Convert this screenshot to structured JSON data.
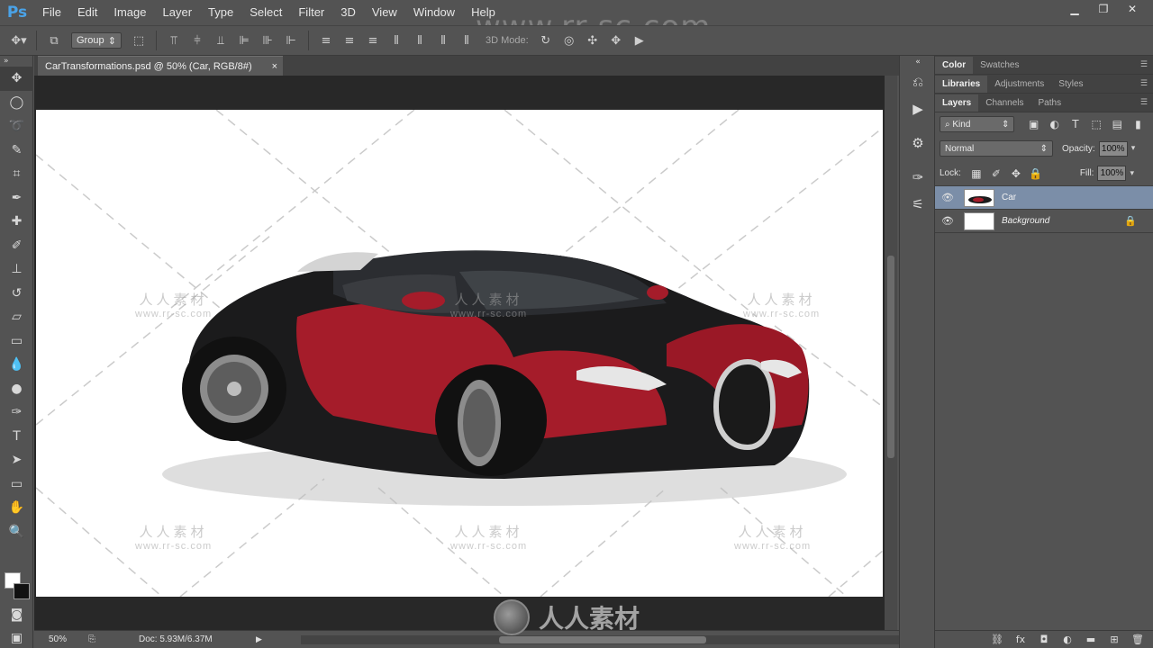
{
  "app": {
    "logo": "Ps"
  },
  "menu": [
    "File",
    "Edit",
    "Image",
    "Layer",
    "Type",
    "Select",
    "Filter",
    "3D",
    "View",
    "Window",
    "Help"
  ],
  "window_controls": {
    "minimize": "▁",
    "restore": "❐",
    "close": "✕"
  },
  "options_bar": {
    "group_select": "Group",
    "mode_3d_label": "3D Mode:"
  },
  "document": {
    "tab_title": "CarTransformations.psd @ 50% (Car, RGB/8#)",
    "tab_close": "×"
  },
  "status": {
    "zoom": "50%",
    "doc_size": "Doc: 5.93M/6.37M"
  },
  "panels": {
    "row1_tabs": [
      "Color",
      "Swatches"
    ],
    "row2_tabs": [
      "Libraries",
      "Adjustments",
      "Styles"
    ],
    "row3_tabs": [
      "Layers",
      "Channels",
      "Paths"
    ]
  },
  "layers": {
    "filter_kind": "Kind",
    "blend_mode": "Normal",
    "opacity_label": "Opacity:",
    "opacity_value": "100%",
    "lock_label": "Lock:",
    "fill_label": "Fill:",
    "fill_value": "100%",
    "items": [
      {
        "name": "Car",
        "selected": true
      },
      {
        "name": "Background",
        "selected": false,
        "locked": true
      }
    ]
  },
  "watermark": {
    "top": "www.rr-sc.com",
    "cn": "人人素材",
    "url": "www.rr-sc.com",
    "bottom": "人人素材"
  },
  "colors": {
    "accent_ps": "#4aa3e8",
    "selected_layer": "#7b8ea8",
    "car_red": "#a51c2a"
  }
}
